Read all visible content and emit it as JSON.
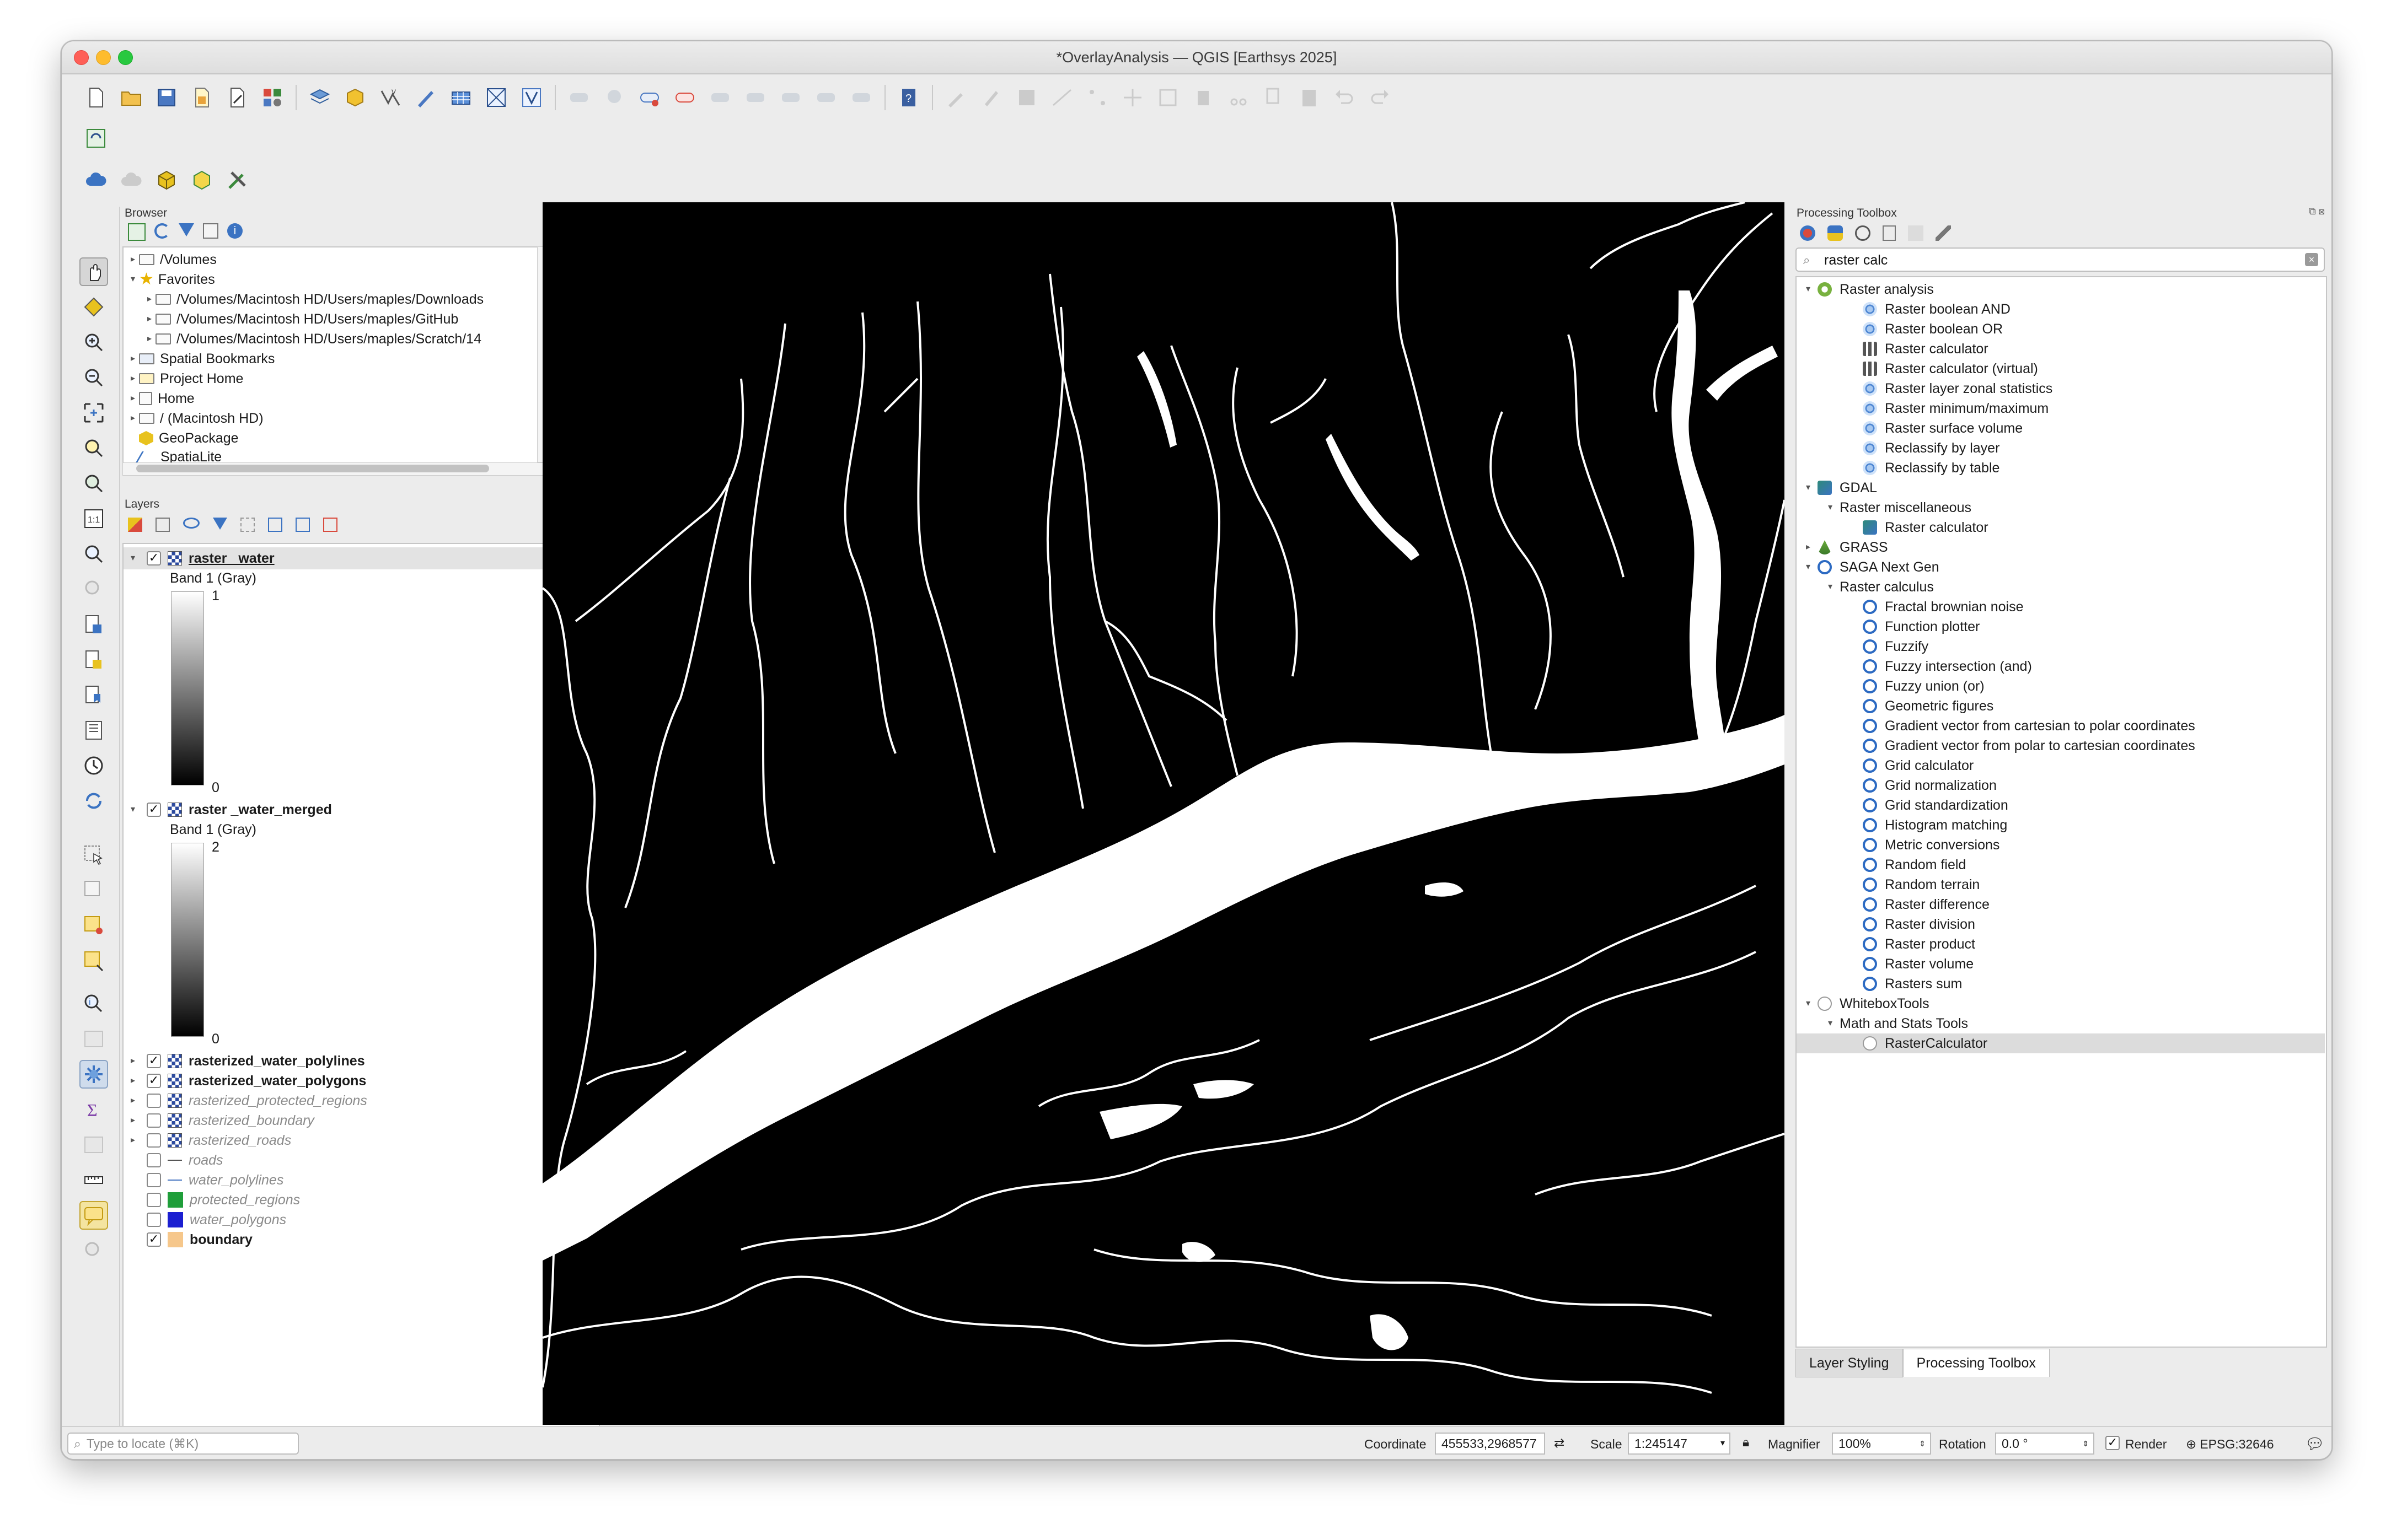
{
  "window": {
    "title": "*OverlayAnalysis — QGIS [Earthsys 2025]"
  },
  "colors": {
    "accent": "#2c6ac2",
    "map_background": "#000000",
    "water": "#ffffff",
    "close": "#fe5f57",
    "minimize": "#febc2e",
    "zoom": "#28c840"
  },
  "browser": {
    "title": "Browser",
    "items": [
      {
        "label": "/Volumes",
        "indent": 0
      },
      {
        "label": "Favorites",
        "indent": 0
      },
      {
        "label": "/Volumes/Macintosh HD/Users/maples/Downloads",
        "indent": 1
      },
      {
        "label": "/Volumes/Macintosh HD/Users/maples/GitHub",
        "indent": 1
      },
      {
        "label": "/Volumes/Macintosh HD/Users/maples/Scratch/14",
        "indent": 1
      },
      {
        "label": "Spatial Bookmarks",
        "indent": 0
      },
      {
        "label": "Project Home",
        "indent": 0
      },
      {
        "label": "Home",
        "indent": 0
      },
      {
        "label": "/ (Macintosh HD)",
        "indent": 0
      },
      {
        "label": "GeoPackage",
        "indent": 0
      },
      {
        "label": "SpatiaLite",
        "indent": 0
      }
    ]
  },
  "layers": {
    "title": "Layers",
    "raster_water": {
      "name": "raster _water",
      "band": "Band 1 (Gray)",
      "max": "1",
      "min": "0"
    },
    "raster_water_merged": {
      "name": "raster _water_merged",
      "band": "Band 1 (Gray)",
      "max": "2",
      "min": "0"
    },
    "items": [
      {
        "name": "rasterized_water_polylines",
        "checked": true,
        "style": "bold"
      },
      {
        "name": "rasterized_water_polygons",
        "checked": true,
        "style": "bold"
      },
      {
        "name": "rasterized_protected_regions",
        "checked": false,
        "style": "italic"
      },
      {
        "name": "rasterized_boundary",
        "checked": false,
        "style": "italic"
      },
      {
        "name": "rasterized_roads",
        "checked": false,
        "style": "italic"
      },
      {
        "name": "roads",
        "checked": false,
        "style": "italic",
        "symbol": "line"
      },
      {
        "name": "water_polylines",
        "checked": false,
        "style": "italic",
        "symbol": "line-blue"
      },
      {
        "name": "protected_regions",
        "checked": false,
        "style": "italic",
        "symbol": "#1f9e3a"
      },
      {
        "name": "water_polygons",
        "checked": false,
        "style": "italic",
        "symbol": "#1b1fd1"
      },
      {
        "name": "boundary",
        "checked": true,
        "style": "bold",
        "symbol": "#f6c78b"
      }
    ]
  },
  "toolbox": {
    "title": "Processing Toolbox",
    "search": "raster calc",
    "tree": [
      {
        "label": "Raster analysis",
        "level": 0,
        "icon": "qgis-icon",
        "open": true
      },
      {
        "label": "Raster boolean AND",
        "level": 2,
        "icon": "gear-icon"
      },
      {
        "label": "Raster boolean OR",
        "level": 2,
        "icon": "gear-icon"
      },
      {
        "label": "Raster calculator",
        "level": 2,
        "icon": "calculator-icon"
      },
      {
        "label": "Raster calculator (virtual)",
        "level": 2,
        "icon": "calculator-icon"
      },
      {
        "label": "Raster layer zonal statistics",
        "level": 2,
        "icon": "gear-icon"
      },
      {
        "label": "Raster minimum/maximum",
        "level": 2,
        "icon": "gear-icon"
      },
      {
        "label": "Raster surface volume",
        "level": 2,
        "icon": "gear-icon"
      },
      {
        "label": "Reclassify by layer",
        "level": 2,
        "icon": "gear-icon"
      },
      {
        "label": "Reclassify by table",
        "level": 2,
        "icon": "gear-icon"
      },
      {
        "label": "GDAL",
        "level": 0,
        "icon": "gdal-icon",
        "open": true
      },
      {
        "label": "Raster miscellaneous",
        "level": 1,
        "open": true
      },
      {
        "label": "Raster calculator",
        "level": 3,
        "icon": "gdal-icon"
      },
      {
        "label": "GRASS",
        "level": 0,
        "icon": "grass-icon",
        "open": false
      },
      {
        "label": "SAGA Next Gen",
        "level": 0,
        "icon": "saga-icon",
        "open": true
      },
      {
        "label": "Raster calculus",
        "level": 1,
        "open": true
      },
      {
        "label": "Fractal brownian noise",
        "level": 3,
        "icon": "saga-icon"
      },
      {
        "label": "Function plotter",
        "level": 3,
        "icon": "saga-icon"
      },
      {
        "label": "Fuzzify",
        "level": 3,
        "icon": "saga-icon"
      },
      {
        "label": "Fuzzy intersection (and)",
        "level": 3,
        "icon": "saga-icon"
      },
      {
        "label": "Fuzzy union (or)",
        "level": 3,
        "icon": "saga-icon"
      },
      {
        "label": "Geometric figures",
        "level": 3,
        "icon": "saga-icon"
      },
      {
        "label": "Gradient vector from cartesian to polar coordinates",
        "level": 3,
        "icon": "saga-icon"
      },
      {
        "label": "Gradient vector from polar to cartesian coordinates",
        "level": 3,
        "icon": "saga-icon"
      },
      {
        "label": "Grid calculator",
        "level": 3,
        "icon": "saga-icon"
      },
      {
        "label": "Grid normalization",
        "level": 3,
        "icon": "saga-icon"
      },
      {
        "label": "Grid standardization",
        "level": 3,
        "icon": "saga-icon"
      },
      {
        "label": "Histogram matching",
        "level": 3,
        "icon": "saga-icon"
      },
      {
        "label": "Metric conversions",
        "level": 3,
        "icon": "saga-icon"
      },
      {
        "label": "Random field",
        "level": 3,
        "icon": "saga-icon"
      },
      {
        "label": "Random terrain",
        "level": 3,
        "icon": "saga-icon"
      },
      {
        "label": "Raster difference",
        "level": 3,
        "icon": "saga-icon"
      },
      {
        "label": "Raster division",
        "level": 3,
        "icon": "saga-icon"
      },
      {
        "label": "Raster product",
        "level": 3,
        "icon": "saga-icon"
      },
      {
        "label": "Raster volume",
        "level": 3,
        "icon": "saga-icon"
      },
      {
        "label": "Rasters sum",
        "level": 3,
        "icon": "saga-icon"
      },
      {
        "label": "WhiteboxTools",
        "level": 0,
        "icon": "whitebox-icon",
        "open": true
      },
      {
        "label": "Math and Stats Tools",
        "level": 1,
        "open": true
      },
      {
        "label": "RasterCalculator",
        "level": 3,
        "icon": "whitebox-icon",
        "selected": true
      }
    ],
    "tabs": [
      "Layer Styling",
      "Processing Toolbox"
    ]
  },
  "status": {
    "locate_placeholder": "Type to locate (⌘K)",
    "coordinate_label": "Coordinate",
    "coordinate": "455533,2968577",
    "scale_label": "Scale",
    "scale": "1:245147",
    "magnifier_label": "Magnifier",
    "magnifier": "100%",
    "rotation_label": "Rotation",
    "rotation": "0.0 °",
    "render_label": "Render",
    "crs": "EPSG:32646"
  }
}
